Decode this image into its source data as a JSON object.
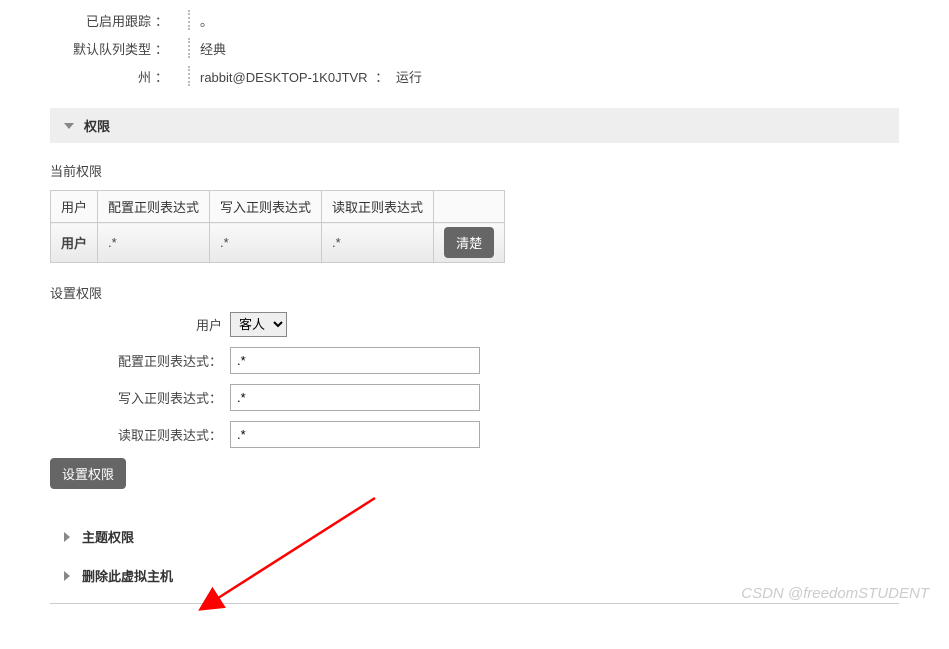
{
  "details": {
    "tracking_label": "已启用跟踪",
    "tracking_value": "。",
    "queue_label": "默认队列类型",
    "queue_value": "经典",
    "state_label": "州",
    "state_node": "rabbit@DESKTOP-1K0JTVR",
    "state_status": "运行"
  },
  "permissions": {
    "section_title": "权限",
    "current_label": "当前权限",
    "table": {
      "headers": [
        "用户",
        "配置正则表达式",
        "写入正则表达式",
        "读取正则表达式"
      ],
      "row": [
        "用户",
        ".*",
        ".*",
        ".*"
      ],
      "clear_button": "清楚"
    },
    "set_label": "设置权限",
    "form": {
      "user_label": "用户",
      "user_selected": "客人",
      "config_label": "配置正则表达式：",
      "config_value": ".*",
      "write_label": "写入正则表达式：",
      "write_value": ".*",
      "read_label": "读取正则表达式：",
      "read_value": ".*",
      "submit": "设置权限"
    }
  },
  "collapsed_sections": {
    "topic": "主题权限",
    "delete_vhost": "删除此虚拟主机"
  },
  "watermark": "CSDN @freedomSTUDENT"
}
